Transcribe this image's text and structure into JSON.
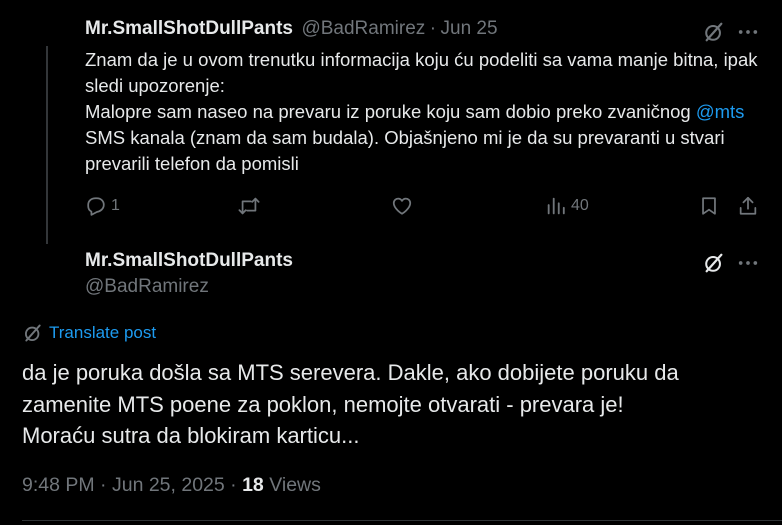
{
  "quoted_post": {
    "display_name": "Mr.SmallShotDullPants",
    "handle": "@BadRamirez",
    "separator": "·",
    "date": "Jun 25",
    "text_line_1": "Znam da je u ovom trenutku informacija koju ću podeliti sa vama manje bitna, ipak sledi upozorenje:",
    "text_line_2_before": "Malopre sam naseo na prevaru iz poruke koju sam dobio preko zvaničnog ",
    "mention": "@mts",
    "text_line_2_after": " SMS kanala (znam da sam budala). Objašnjeno mi je da su prevaranti u stvari prevarili telefon da pomisli",
    "reply_count": "1",
    "repost_count": "",
    "like_count": "",
    "view_count": "40",
    "colors": {
      "text": "#e7e9ea",
      "muted": "#71767b",
      "link": "#1d9bf0"
    }
  },
  "main_post": {
    "display_name": "Mr.SmallShotDullPants",
    "handle": "@BadRamirez",
    "translate_label": "Translate post",
    "text_line_1": "da je poruka došla sa MTS serevera. Dakle, ako dobijete poruku da zamenite MTS poene za poklon, nemojte otvarati - prevara je!",
    "text_line_2": "Moraću sutra da blokiram karticu...",
    "time": "9:48 PM",
    "separator": "·",
    "date": "Jun 25, 2025",
    "views_number": "18",
    "views_label": "Views"
  },
  "icons": {
    "grok": "grok-icon",
    "more": "more-icon",
    "reply": "reply-icon",
    "repost": "repost-icon",
    "like": "like-icon",
    "views": "views-icon",
    "bookmark": "bookmark-icon",
    "share": "share-icon",
    "translate": "translate-icon"
  }
}
